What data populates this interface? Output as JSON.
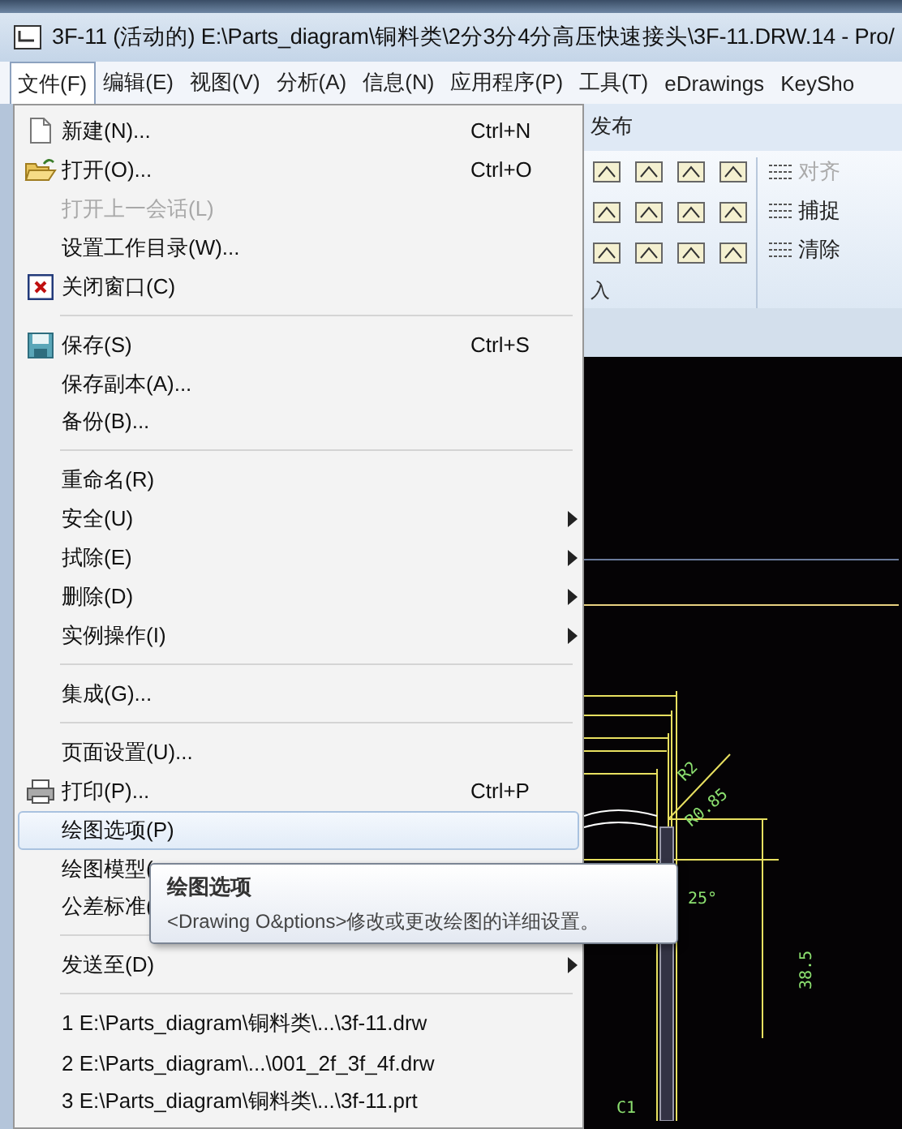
{
  "window": {
    "title": "3F-11 (活动的) E:\\Parts_diagram\\铜料类\\2分3分4分高压快速接头\\3F-11.DRW.14 - Pro/"
  },
  "menu_bar": [
    {
      "label": "文件(F)",
      "selected": true
    },
    {
      "label": "编辑(E)",
      "selected": false
    },
    {
      "label": "视图(V)",
      "selected": false
    },
    {
      "label": "分析(A)",
      "selected": false
    },
    {
      "label": "信息(N)",
      "selected": false
    },
    {
      "label": "应用程序(P)",
      "selected": false
    },
    {
      "label": "工具(T)",
      "selected": false
    },
    {
      "label": "eDrawings",
      "selected": false
    },
    {
      "label": "KeySho",
      "selected": false
    }
  ],
  "file_menu": {
    "sections": [
      [
        {
          "kind": "new",
          "label": "新建(N)...",
          "shortcut": "Ctrl+N",
          "disabled": false,
          "selected": false,
          "submenu": false
        },
        {
          "kind": "open",
          "label": "打开(O)...",
          "shortcut": "Ctrl+O",
          "disabled": false,
          "selected": false,
          "submenu": false
        },
        {
          "kind": "plain",
          "label": "打开上一会话(L)",
          "disabled": true,
          "selected": false,
          "submenu": false
        },
        {
          "kind": "plain",
          "label": "设置工作目录(W)...",
          "disabled": false,
          "selected": false,
          "submenu": false
        },
        {
          "kind": "close",
          "label": "关闭窗口(C)",
          "disabled": false,
          "selected": false,
          "submenu": false
        }
      ],
      [
        {
          "kind": "save",
          "label": "保存(S)",
          "shortcut": "Ctrl+S",
          "disabled": false,
          "selected": false,
          "submenu": false
        },
        {
          "kind": "plain",
          "label": "保存副本(A)...",
          "disabled": false,
          "selected": false,
          "submenu": false
        },
        {
          "kind": "plain",
          "label": "备份(B)...",
          "disabled": false,
          "selected": false,
          "submenu": false
        }
      ],
      [
        {
          "kind": "plain",
          "label": "重命名(R)",
          "disabled": false,
          "selected": false,
          "submenu": false
        },
        {
          "kind": "plain",
          "label": "安全(U)",
          "disabled": false,
          "selected": false,
          "submenu": true
        },
        {
          "kind": "plain",
          "label": "拭除(E)",
          "disabled": false,
          "selected": false,
          "submenu": true
        },
        {
          "kind": "plain",
          "label": "删除(D)",
          "disabled": false,
          "selected": false,
          "submenu": true
        },
        {
          "kind": "plain",
          "label": "实例操作(I)",
          "disabled": false,
          "selected": false,
          "submenu": true
        }
      ],
      [
        {
          "kind": "plain",
          "label": "集成(G)...",
          "disabled": false,
          "selected": false,
          "submenu": false
        }
      ],
      [
        {
          "kind": "plain",
          "label": "页面设置(U)...",
          "disabled": false,
          "selected": false,
          "submenu": false
        },
        {
          "kind": "print",
          "label": "打印(P)...",
          "shortcut": "Ctrl+P",
          "disabled": false,
          "selected": false,
          "submenu": false
        },
        {
          "kind": "plain",
          "label": "绘图选项(P)",
          "disabled": false,
          "selected": true,
          "submenu": false
        },
        {
          "kind": "plain",
          "label": "绘图模型(",
          "disabled": false,
          "selected": false,
          "submenu": false
        },
        {
          "kind": "plain",
          "label": "公差标准(",
          "disabled": false,
          "selected": false,
          "submenu": false
        }
      ],
      [
        {
          "kind": "plain",
          "label": "发送至(D)",
          "disabled": false,
          "selected": false,
          "submenu": true
        }
      ],
      [
        {
          "kind": "plain",
          "label": "1 E:\\Parts_diagram\\铜料类\\...\\3f-11.drw",
          "disabled": false,
          "selected": false,
          "submenu": false
        },
        {
          "kind": "plain",
          "label": "2 E:\\Parts_diagram\\...\\001_2f_3f_4f.drw",
          "disabled": false,
          "selected": false,
          "submenu": false
        },
        {
          "kind": "plain",
          "label": "3 E:\\Parts_diagram\\铜料类\\...\\3f-11.prt",
          "disabled": false,
          "selected": false,
          "submenu": false
        }
      ]
    ]
  },
  "tooltip": {
    "title": "绘图选项",
    "text": "<Drawing O&ptions>修改或更改绘图的详细设置。"
  },
  "ribbon": {
    "tab": "发布",
    "group_label": "入",
    "commands": [
      {
        "label": "对齐",
        "disabled": true
      },
      {
        "label": "捕捉",
        "disabled": false
      },
      {
        "label": "清除",
        "disabled": false
      }
    ]
  },
  "cad_labels": [
    "R2",
    "R0.85",
    "25°",
    "38.5",
    "C1"
  ]
}
